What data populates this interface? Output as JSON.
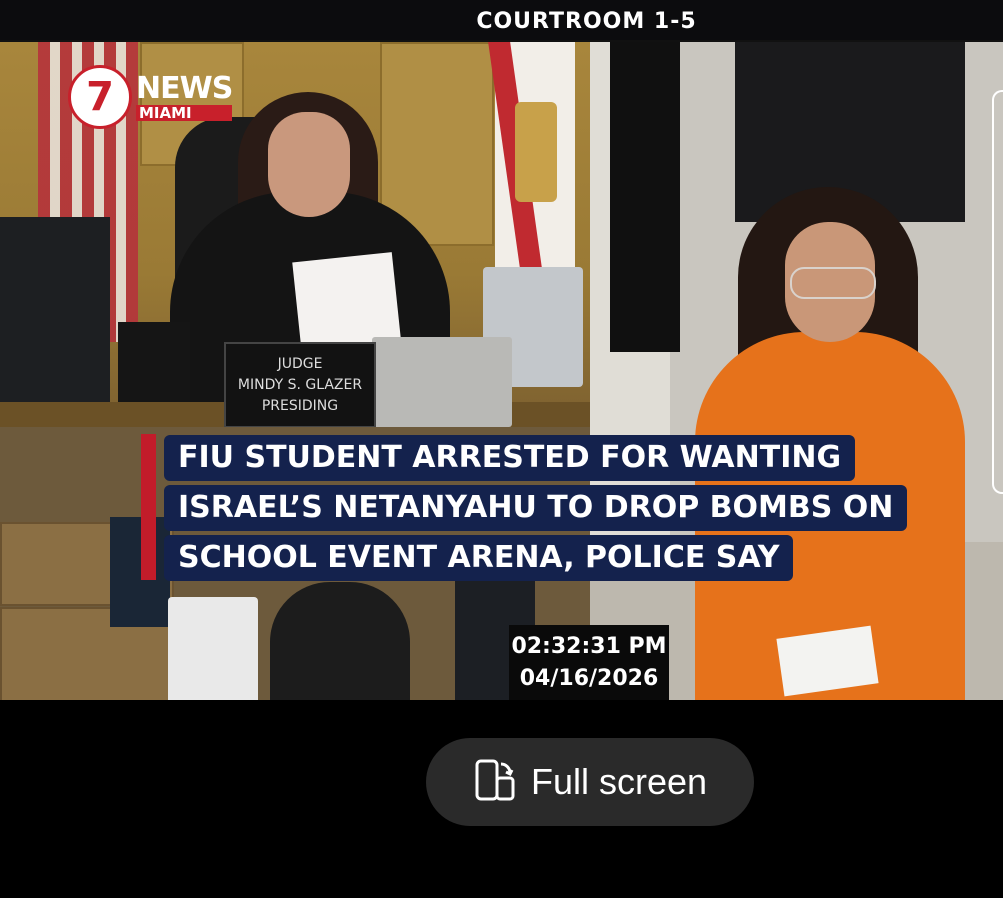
{
  "video": {
    "top_label": "COURTROOM 1-5",
    "logo": {
      "number": "7",
      "news": "NEWS",
      "city": "MIAMI",
      "brand_red": "#c8202b"
    },
    "nameplate": {
      "line1": "JUDGE",
      "line2": "MINDY S. GLAZER",
      "line3": "PRESIDING"
    },
    "headline": [
      "FIU STUDENT ARRESTED FOR WANTING",
      "ISRAEL’S NETANYAHU TO DROP BOMBS ON",
      "SCHOOL EVENT ARENA, POLICE SAY"
    ],
    "headline_bg": "#14224d",
    "accent_red": "#c21c2a",
    "timestamp": {
      "time": "02:32:31 PM",
      "date": "04/16/2026"
    }
  },
  "controls": {
    "fullscreen_label": "Full screen",
    "fullscreen_icon": "rotate-phone-icon"
  }
}
